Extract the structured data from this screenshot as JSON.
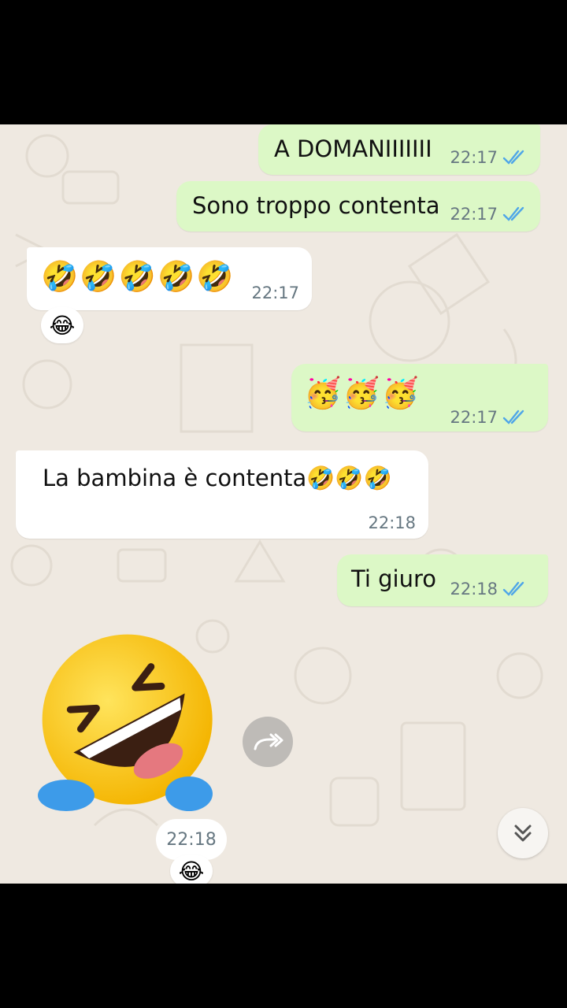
{
  "colors": {
    "outgoing_bubble": "#dcf8c6",
    "incoming_bubble": "#ffffff",
    "chat_background": "#efe9e1",
    "read_ticks": "#4fa6e8",
    "timestamp": "#667781"
  },
  "messages": [
    {
      "direction": "outgoing",
      "text": "A DOMANIIIIIII",
      "time": "22:17",
      "status_icon": "double-check-read-icon"
    },
    {
      "direction": "outgoing",
      "text": "Sono troppo contenta",
      "time": "22:17",
      "status_icon": "double-check-read-icon"
    },
    {
      "direction": "incoming",
      "text": "🤣🤣🤣🤣🤣",
      "time": "22:17",
      "reaction": "😂"
    },
    {
      "direction": "outgoing",
      "text": "🥳🥳🥳",
      "time": "22:17",
      "status_icon": "double-check-read-icon"
    },
    {
      "direction": "incoming",
      "text": "La bambina è contenta🤣🤣🤣",
      "time": "22:18"
    },
    {
      "direction": "outgoing",
      "text": "Ti giuro",
      "time": "22:18",
      "status_icon": "double-check-read-icon"
    },
    {
      "direction": "incoming",
      "type": "sticker",
      "sticker": "rolling-on-floor-laughing-sticker",
      "time": "22:18",
      "reaction": "😂"
    }
  ],
  "controls": {
    "forward_icon": "forward-icon",
    "scroll_down_icon": "double-chevron-down-icon"
  }
}
